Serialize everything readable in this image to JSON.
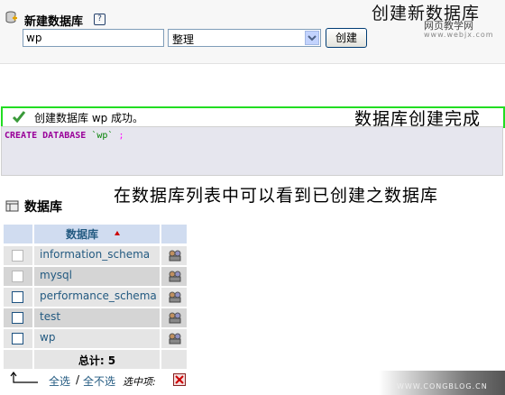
{
  "create": {
    "title": "新建数据库",
    "help_icon": "?",
    "db_name_value": "wp",
    "collation_value": "整理",
    "create_button": "创建"
  },
  "annotations": {
    "create_db": "创建新数据库",
    "created_done": "数据库创建完成",
    "list_hint": "在数据库列表中可以看到已创建之数据库"
  },
  "watermarks": {
    "top_text": "网页教学网",
    "top_url": "www.webjx.com",
    "bottom_url": "WWW.CONGBLOG.CN"
  },
  "success": {
    "message": "创建数据库 wp 成功。",
    "icon": "check-icon"
  },
  "sql": {
    "kw1": "CREATE DATABASE",
    "name": "`wp`",
    "end": ";"
  },
  "databases": {
    "title": "数据库",
    "header": "数据库",
    "rows": [
      {
        "name": "information_schema",
        "checkbox_enabled": false
      },
      {
        "name": "mysql",
        "checkbox_enabled": false
      },
      {
        "name": "performance_schema",
        "checkbox_enabled": true
      },
      {
        "name": "test",
        "checkbox_enabled": true
      },
      {
        "name": "wp",
        "checkbox_enabled": true
      }
    ],
    "total": "总计: 5"
  },
  "footer": {
    "check_all": "全选",
    "separator": "/",
    "uncheck_all": "全不选",
    "with_selected": "选中项:"
  },
  "colors": {
    "success_border": "#22dd22",
    "link": "#235a81",
    "sql_keyword": "#990099"
  }
}
